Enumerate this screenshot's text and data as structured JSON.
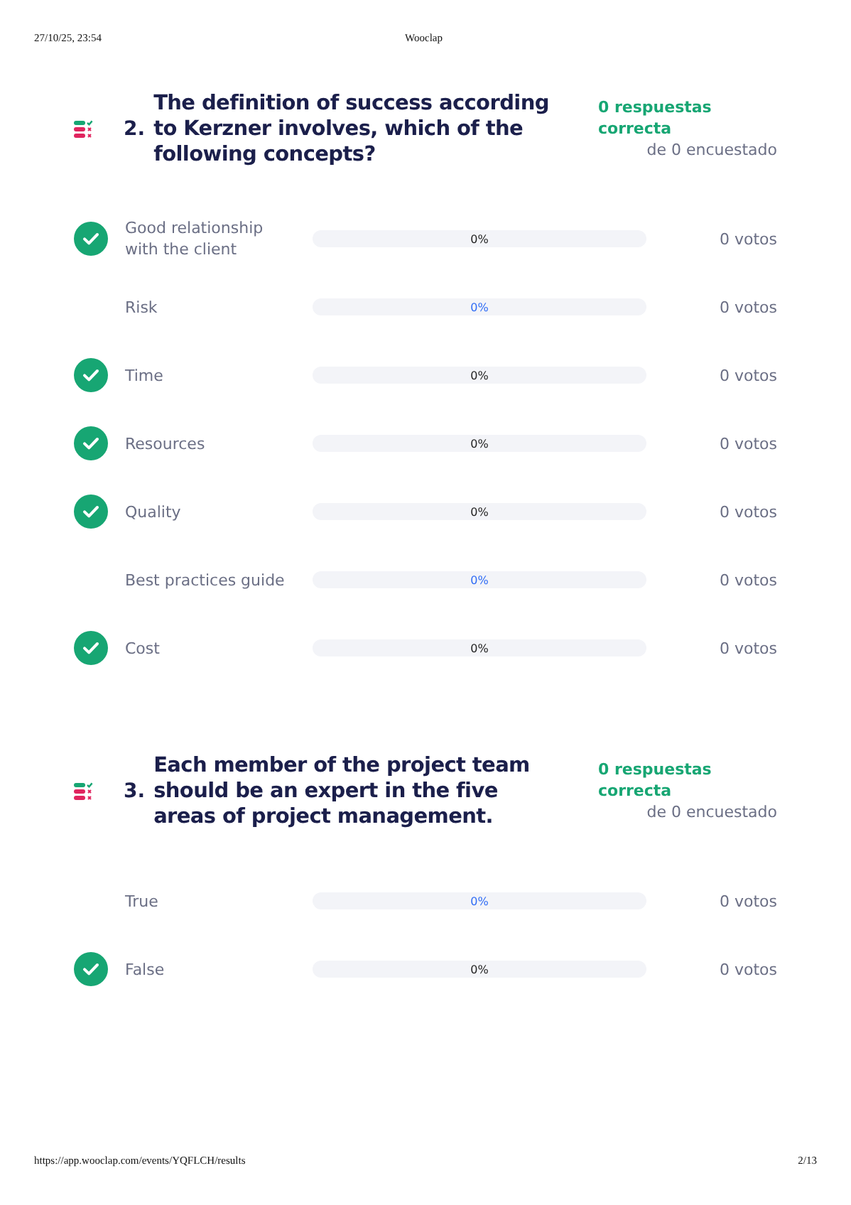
{
  "print_header": {
    "datetime": "27/10/25, 23:54",
    "title": "Wooclap"
  },
  "questions": [
    {
      "number": "2.",
      "text": "The definition of success according to Kerzner involves, which of the following concepts?",
      "correct_count": "0 respuestas correcta",
      "respondents": "de 0 encuestado",
      "options": [
        {
          "label": "Good relationship with the client",
          "correct": true,
          "percent": "0%",
          "votes": "0 votos"
        },
        {
          "label": "Risk",
          "correct": false,
          "percent": "0%",
          "votes": "0 votos"
        },
        {
          "label": "Time",
          "correct": true,
          "percent": "0%",
          "votes": "0 votos"
        },
        {
          "label": "Resources",
          "correct": true,
          "percent": "0%",
          "votes": "0 votos"
        },
        {
          "label": "Quality",
          "correct": true,
          "percent": "0%",
          "votes": "0 votos"
        },
        {
          "label": "Best practices guide",
          "correct": false,
          "percent": "0%",
          "votes": "0 votos"
        },
        {
          "label": "Cost",
          "correct": true,
          "percent": "0%",
          "votes": "0 votos"
        }
      ]
    },
    {
      "number": "3.",
      "text": "Each member of the project team should be an expert in the five areas of project management.",
      "correct_count": "0 respuestas correcta",
      "respondents": "de 0 encuestado",
      "options": [
        {
          "label": "True",
          "correct": false,
          "percent": "0%",
          "votes": "0 votos"
        },
        {
          "label": "False",
          "correct": true,
          "percent": "0%",
          "votes": "0 votos"
        }
      ]
    }
  ],
  "print_footer": {
    "url": "https://app.wooclap.com/events/YQFLCH/results",
    "page": "2/13"
  }
}
